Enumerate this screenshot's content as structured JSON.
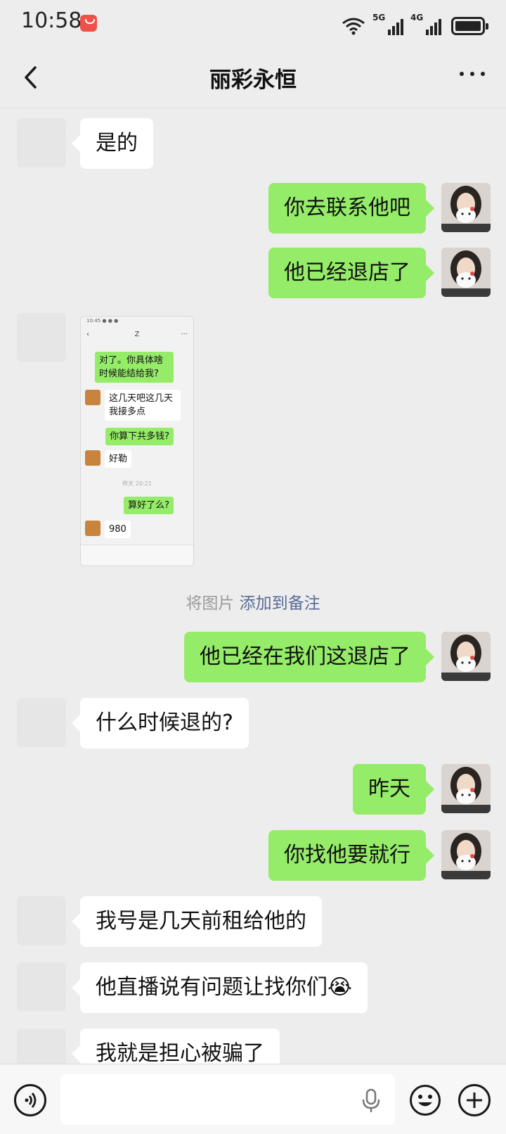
{
  "status_bar": {
    "time": "10:58",
    "network_1": "5G",
    "network_2": "4G"
  },
  "header": {
    "title": "丽彩永恒"
  },
  "messages": [
    {
      "side": "in",
      "text": "是的"
    },
    {
      "side": "out",
      "text": "你去联系他吧"
    },
    {
      "side": "out",
      "text": "他已经退店了"
    },
    {
      "side": "out",
      "text": "他已经在我们这退店了"
    },
    {
      "side": "in",
      "text": "什么时候退的?"
    },
    {
      "side": "out",
      "text": "昨天"
    },
    {
      "side": "out",
      "text": "你找他要就行"
    },
    {
      "side": "in",
      "text": "我号是几天前租给他的"
    },
    {
      "side": "in",
      "text": "他直播说有问题让找你们😭"
    },
    {
      "side": "in",
      "text": "我就是担心被骗了"
    }
  ],
  "image_message": {
    "nav_title": "Z",
    "bubbles": [
      {
        "side": "out",
        "text": "对了。你具体啥时候能结给我?"
      },
      {
        "side": "in",
        "text": "这几天吧这几天我接多点"
      },
      {
        "side": "out",
        "text": "你算下共多钱?"
      },
      {
        "side": "in",
        "text": "好勒"
      },
      {
        "side": "out",
        "text": "算好了么?"
      },
      {
        "side": "in",
        "text": "980"
      }
    ],
    "time_label": "昨天 20:21"
  },
  "system_note": {
    "prefix": "将图片",
    "link": "添加到备注"
  },
  "colors": {
    "background": "#ededed",
    "outgoing_bubble": "#95ec69",
    "incoming_bubble": "#ffffff",
    "link": "#576b95"
  },
  "icons": [
    "back-arrow-icon",
    "more-icon",
    "voice-icon",
    "mic-icon",
    "emoji-icon",
    "plus-icon"
  ]
}
